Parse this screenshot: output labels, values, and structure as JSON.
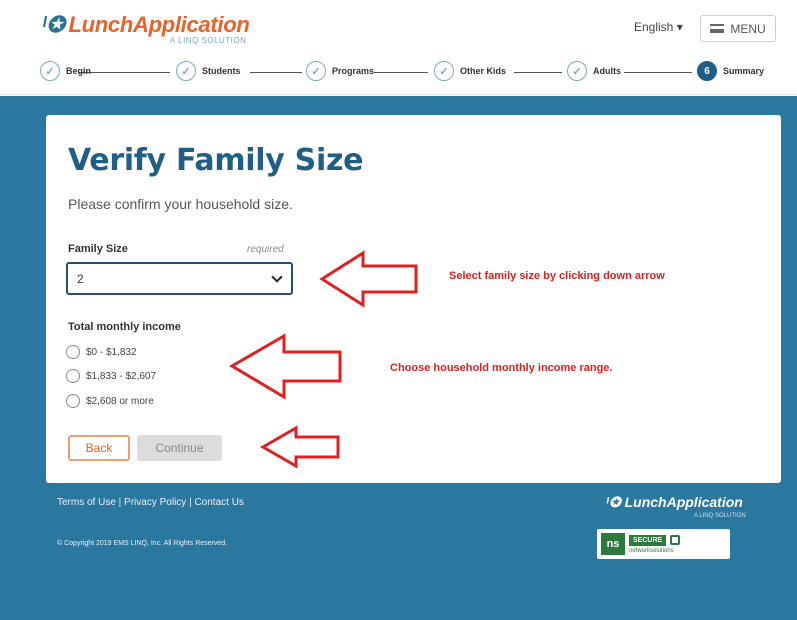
{
  "header": {
    "logo_main": "LunchApplication",
    "logo_sub": "A LINQ SOLUTION",
    "language": "English ▾",
    "menu_label": "MENU"
  },
  "stepper": {
    "steps": [
      {
        "label": "Begin",
        "status": "done",
        "icon": "✓"
      },
      {
        "label": "Students",
        "status": "done",
        "icon": "✓"
      },
      {
        "label": "Programs",
        "status": "done",
        "icon": "✓"
      },
      {
        "label": "Other Kids",
        "status": "done",
        "icon": "✓"
      },
      {
        "label": "Adults",
        "status": "done",
        "icon": "✓"
      },
      {
        "label": "Summary",
        "status": "active",
        "icon": "6"
      }
    ]
  },
  "main": {
    "title": "Verify Family Size",
    "subtitle": "Please confirm your household size.",
    "family_size": {
      "label": "Family Size",
      "required": "required",
      "value": "2"
    },
    "income": {
      "label": "Total monthly income",
      "options": [
        "$0 - $1,832",
        "$1,833 - $2,607",
        "$2,608 or more"
      ]
    },
    "back_label": "Back",
    "continue_label": "Continue"
  },
  "annotations": {
    "family_size": "Select family size by clicking down arrow",
    "income": "Choose household monthly income range."
  },
  "footer": {
    "links": "Terms of Use | Privacy Policy | Contact Us",
    "copyright": "© Copyright 2019 EMS LINQ, Inc. All Rights Reserved.",
    "logo_main": "LunchApplication",
    "logo_sub": "A LINQ SOLUTION",
    "badge_ns": "ns",
    "badge_secure": "SECURE",
    "badge_sub": "networksolutions"
  },
  "colors": {
    "brand_blue": "#2a77a0",
    "brand_orange": "#e8622a",
    "annotation_red": "#e02020"
  }
}
